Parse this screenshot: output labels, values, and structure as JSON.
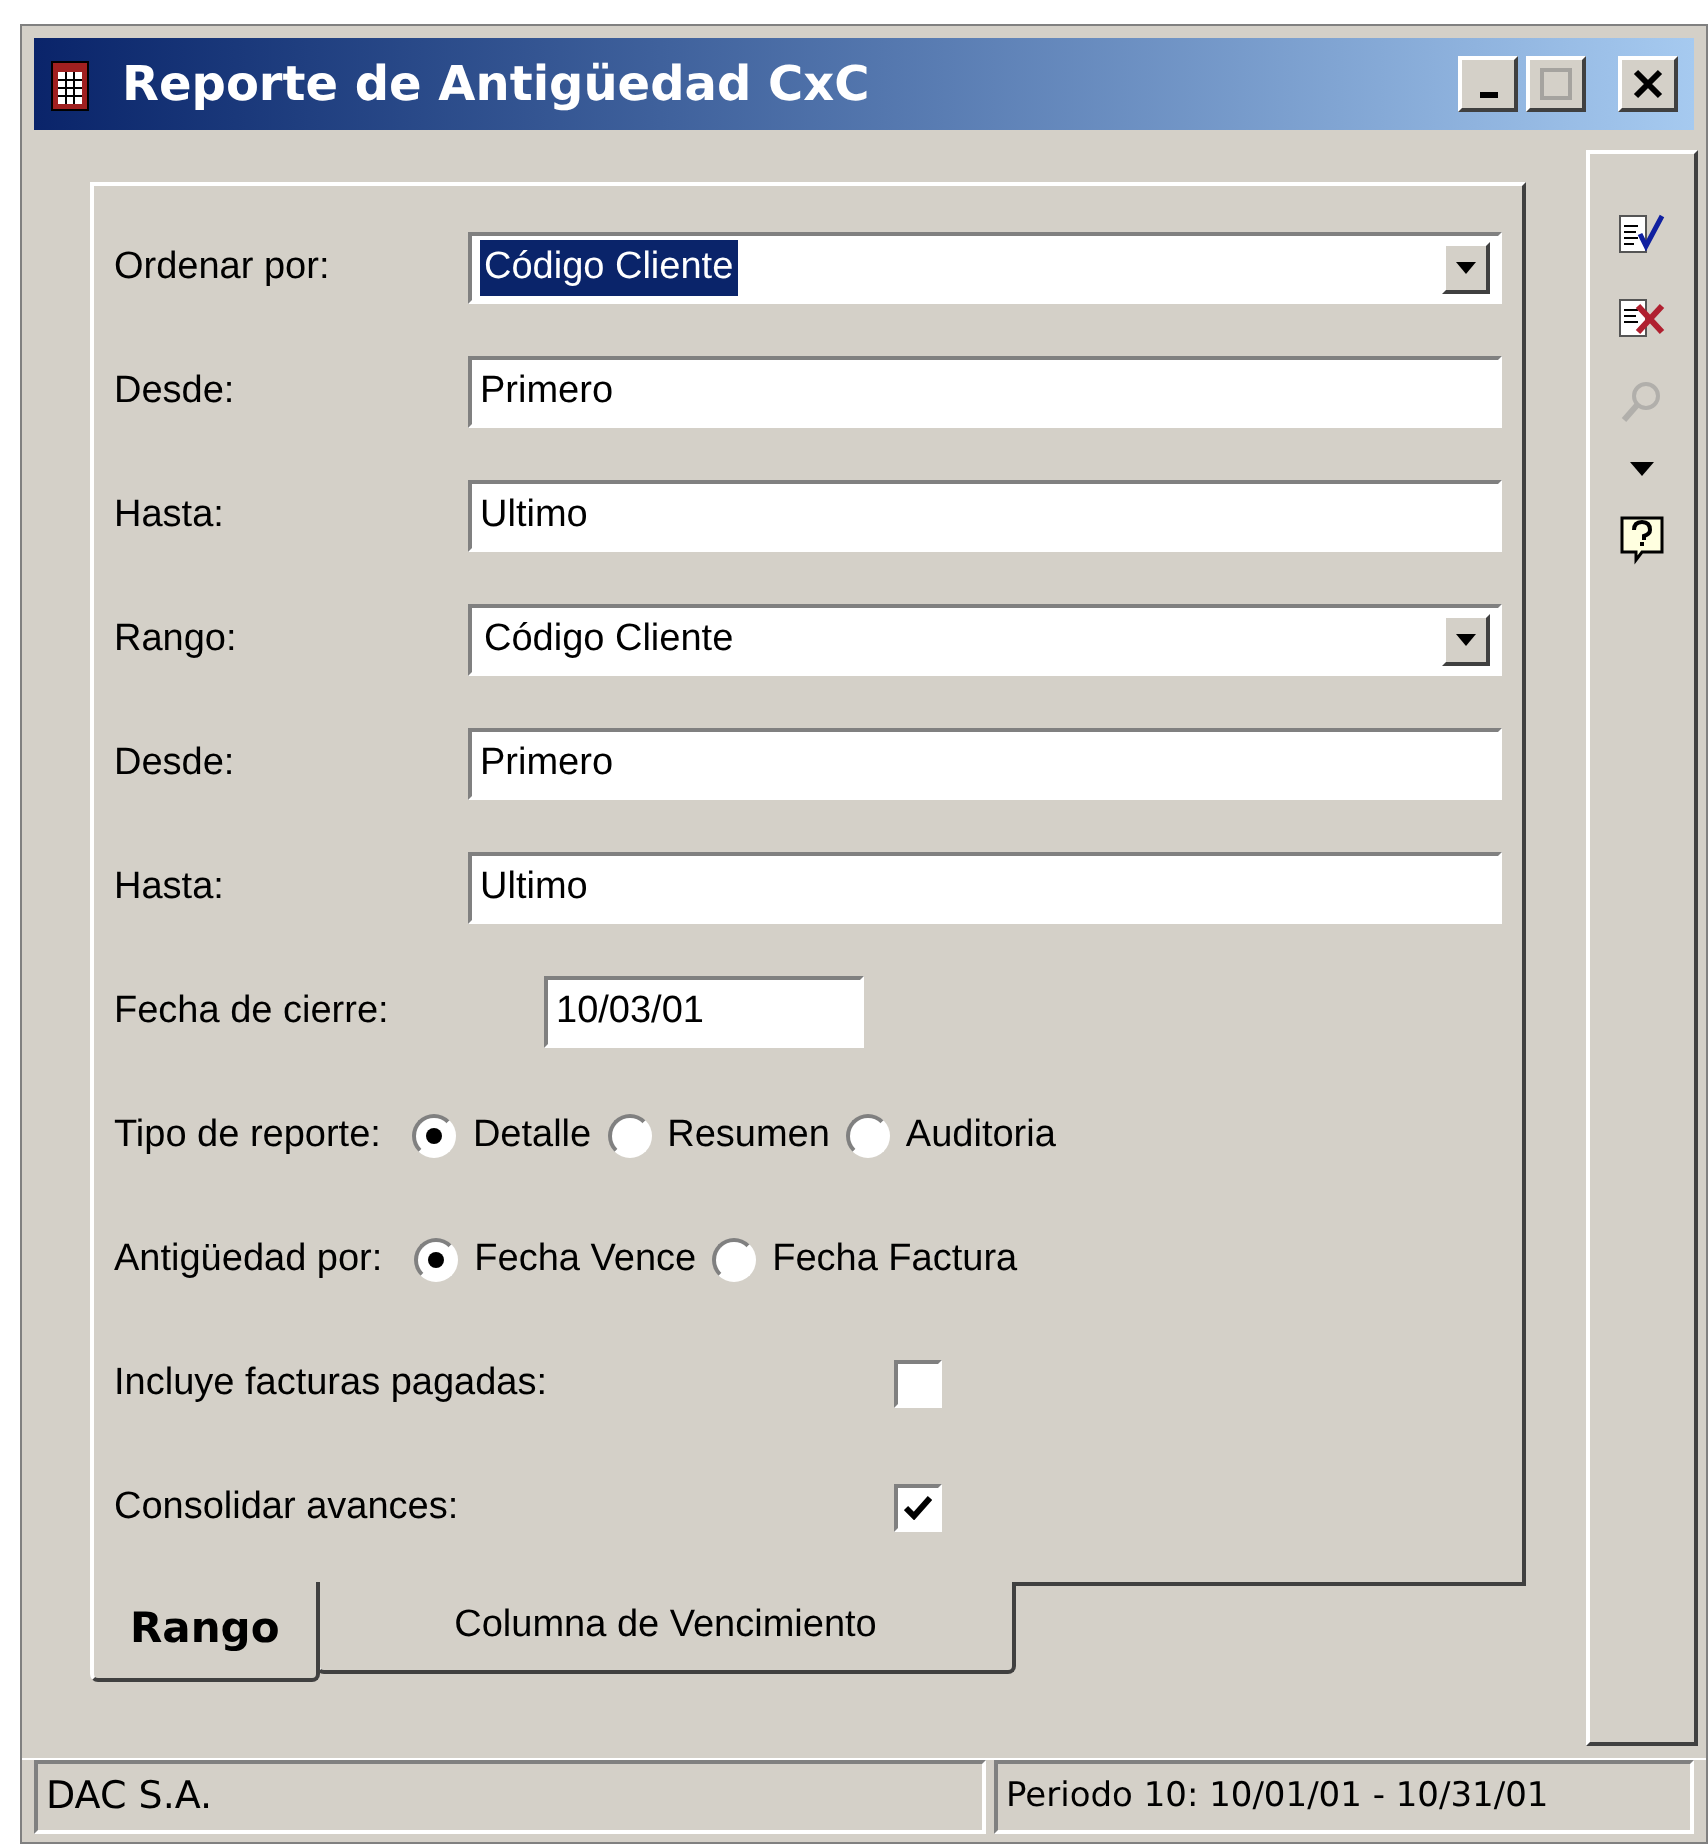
{
  "window": {
    "title": "Reporte de Antigüedad CxC"
  },
  "fields": [
    {
      "kind": "select",
      "label": "Ordenar por:",
      "value": "Código Cliente",
      "focused": true
    },
    {
      "kind": "text",
      "label": "Desde:",
      "value": "Primero"
    },
    {
      "kind": "text",
      "label": "Hasta:",
      "value": "Ultimo"
    },
    {
      "kind": "select",
      "label": "Rango:",
      "value": "Código Cliente",
      "focused": false
    },
    {
      "kind": "text",
      "label": "Desde:",
      "value": "Primero"
    },
    {
      "kind": "text",
      "label": "Hasta:",
      "value": "Ultimo"
    },
    {
      "kind": "date",
      "label": "Fecha de cierre:",
      "value": "10/03/01"
    }
  ],
  "radio_groups": [
    {
      "label": "Tipo de reporte:",
      "options": [
        {
          "label": "Detalle",
          "selected": true
        },
        {
          "label": "Resumen",
          "selected": false
        },
        {
          "label": "Auditoria",
          "selected": false
        }
      ]
    },
    {
      "label": "Antigüedad por:",
      "options": [
        {
          "label": "Fecha Vence",
          "selected": true
        },
        {
          "label": "Fecha Factura",
          "selected": false
        }
      ]
    }
  ],
  "checkboxes": [
    {
      "label": "Incluye facturas pagadas:",
      "checked": false
    },
    {
      "label": "Consolidar avances:",
      "checked": true
    }
  ],
  "tabs": [
    {
      "label": "Rango",
      "selected": true
    },
    {
      "label": "Columna de Vencimiento",
      "selected": false
    }
  ],
  "toolbar": [
    {
      "kind": "accept",
      "disabled": false
    },
    {
      "kind": "cancel",
      "disabled": false
    },
    {
      "kind": "search",
      "disabled": true
    },
    {
      "kind": "dropdown",
      "disabled": false
    },
    {
      "kind": "help",
      "disabled": false
    }
  ],
  "status_bar": {
    "left": "DAC S.A.",
    "right": "Periodo 10: 10/01/01 - 10/31/01"
  }
}
